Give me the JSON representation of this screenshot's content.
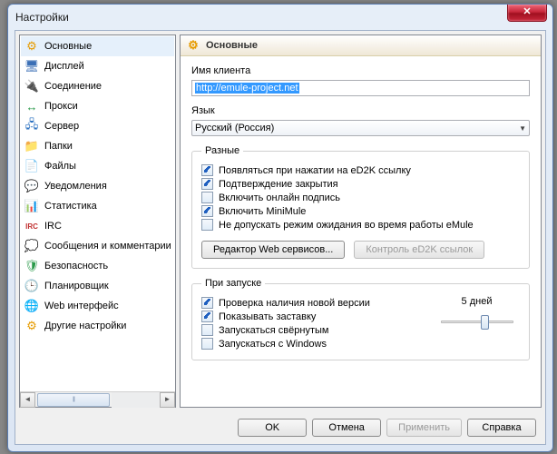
{
  "window": {
    "title": "Настройки",
    "close_glyph": "✕"
  },
  "sidebar": {
    "items": [
      {
        "label": "Основные",
        "icon": "⚙",
        "color": "#e69b00",
        "active": true
      },
      {
        "label": "Дисплей",
        "icon": "🖥",
        "color": "#3b6fb6"
      },
      {
        "label": "Соединение",
        "icon": "🔌",
        "color": "#c03030"
      },
      {
        "label": "Прокси",
        "icon": "↔",
        "color": "#2a9a4a"
      },
      {
        "label": "Сервер",
        "icon": "🖧",
        "color": "#2a70c0"
      },
      {
        "label": "Папки",
        "icon": "📁",
        "color": "#e6b84a"
      },
      {
        "label": "Файлы",
        "icon": "📄",
        "color": "#888"
      },
      {
        "label": "Уведомления",
        "icon": "💬",
        "color": "#3a90d0"
      },
      {
        "label": "Статистика",
        "icon": "📊",
        "color": "#2a60c0"
      },
      {
        "label": "IRC",
        "icon": "IRC",
        "color": "#c03030"
      },
      {
        "label": "Сообщения и комментарии",
        "icon": "💭",
        "color": "#4aa0e0"
      },
      {
        "label": "Безопасность",
        "icon": "🛡",
        "color": "#2a9a4a"
      },
      {
        "label": "Планировщик",
        "icon": "🕒",
        "color": "#3a70c0"
      },
      {
        "label": "Web интерфейс",
        "icon": "🌐",
        "color": "#2a70c0"
      },
      {
        "label": "Другие настройки",
        "icon": "⚙",
        "color": "#e69b00"
      }
    ]
  },
  "main": {
    "title": "Основные",
    "client_name_label": "Имя клиента",
    "client_name_value": "http://emule-project.net",
    "language_label": "Язык",
    "language_value": "Русский (Россия)",
    "misc": {
      "legend": "Разные",
      "items": [
        {
          "label": "Появляться при нажатии на eD2K ссылку",
          "checked": true
        },
        {
          "label": "Подтверждение закрытия",
          "checked": true
        },
        {
          "label": "Включить онлайн подпись",
          "checked": false
        },
        {
          "label": "Включить MiniMule",
          "checked": true
        },
        {
          "label": "Не допускать режим ожидания во время работы eMule",
          "checked": false
        }
      ],
      "btn_web_editor": "Редактор Web сервисов...",
      "btn_ed2k_check": "Контроль eD2K ссылок"
    },
    "startup": {
      "legend": "При запуске",
      "items": [
        {
          "label": "Проверка наличия новой версии",
          "checked": true
        },
        {
          "label": "Показывать заставку",
          "checked": true
        },
        {
          "label": "Запускаться свёрнутым",
          "checked": false
        },
        {
          "label": "Запускаться с Windows",
          "checked": false
        }
      ],
      "days_label": "5 дней"
    }
  },
  "buttons": {
    "ok": "OK",
    "cancel": "Отмена",
    "apply": "Применить",
    "help": "Справка"
  }
}
